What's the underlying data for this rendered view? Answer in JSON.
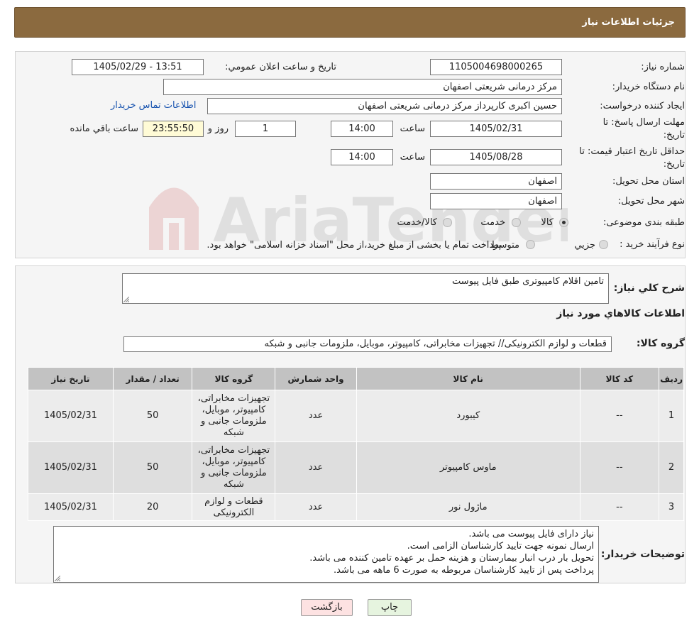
{
  "header": {
    "title": "جزئیات اطلاعات نیاز"
  },
  "form": {
    "need_number_label": "شماره نیاز:",
    "need_number": "1105004698000265",
    "announce_label": "تاریخ و ساعت اعلان عمومي:",
    "announce_value": "1405/02/29 - 13:51",
    "buyer_org_label": "نام دستگاه خريدار:",
    "buyer_org": "مرکز درمانی شریعتی اصفهان",
    "creator_label": "ايجاد کننده درخواست:",
    "creator": "حسین اکبری کارپرداز مرکز درمانی شریعتی اصفهان",
    "contact_link": "اطلاعات تماس خريدار",
    "deadline_label_1": "مهلت ارسال پاسخ: تا",
    "deadline_label_2": "تاریخ:",
    "deadline_date": "1405/02/31",
    "time_label": "ساعت",
    "deadline_time": "14:00",
    "days_value": "1",
    "days_label": "روز و",
    "remaining_time": "23:55:50",
    "remaining_label": "ساعت باقي مانده",
    "validity_label_1": "حداقل تاريخ اعتبار قيمت: تا",
    "validity_label_2": "تاریخ:",
    "validity_date": "1405/08/28",
    "validity_time": "14:00",
    "province_label": "استان محل تحويل:",
    "province": "اصفهان",
    "city_label": "شهر محل تحويل:",
    "city": "اصفهان",
    "category_label": "طبقه بندی موضوعی:",
    "category_options": [
      "کالا",
      "خدمت",
      "کالا/خدمت"
    ],
    "category_selected": 0,
    "process_label": "نوع فرآيند خريد :",
    "process_options": [
      "جزيي",
      "متوسط"
    ],
    "process_selected": -1,
    "process_note": "پرداخت تمام يا بخشی از مبلغ خريد،از محل \"اسناد خزانه اسلامی\" خواهد بود."
  },
  "watermark": {
    "text": "AriaTender.neT"
  },
  "summary": {
    "desc_label": "شرح کلي نياز:",
    "desc_value": "تامین اقلام کامپیوتری طبق فایل پیوست",
    "goods_info_title": "اطلاعات کالاهاي مورد نياز",
    "group_label": "گروه کالا:",
    "group_value": "قطعات و لوازم الکترونیکی// تجهیزات مخابراتی، کامپیوتر، موبایل، ملزومات جانبی و شبکه"
  },
  "table": {
    "columns": [
      "رديف",
      "کد کالا",
      "نام کالا",
      "واحد شمارش",
      "گروه کالا",
      "تعداد / مقدار",
      "تاريخ نياز"
    ],
    "rows": [
      [
        "1",
        "--",
        "کیبورد",
        "عدد",
        "تجهیزات مخابراتی، کامپیوتر، موبایل، ملزومات جانبی و شبکه",
        "50",
        "1405/02/31"
      ],
      [
        "2",
        "--",
        "ماوس کامپیوتر",
        "عدد",
        "تجهیزات مخابراتی، کامپیوتر، موبایل، ملزومات جانبی و شبکه",
        "50",
        "1405/02/31"
      ],
      [
        "3",
        "--",
        "ماژول نور",
        "عدد",
        "قطعات و لوازم الکترونیکی",
        "20",
        "1405/02/31"
      ]
    ]
  },
  "notes": {
    "label": "توضيحات خريدار:",
    "lines": [
      "نیاز دارای فایل پیوست می باشد.",
      "ارسال نمونه جهت تایید کارشناسان الزامی است.",
      "تحویل بار درب انبار بیمارستان و هزینه حمل بر عهده تامین کننده می باشد.",
      "پرداخت پس از تایید کارشناسان مربوطه به صورت 6 ماهه می باشد."
    ]
  },
  "buttons": {
    "print": "چاپ",
    "back": "بازگشت"
  },
  "colors": {
    "header": "#8b6a3f",
    "link": "#1a55b0",
    "back_button": "#fde2e2",
    "print_button": "#e6f4df"
  }
}
